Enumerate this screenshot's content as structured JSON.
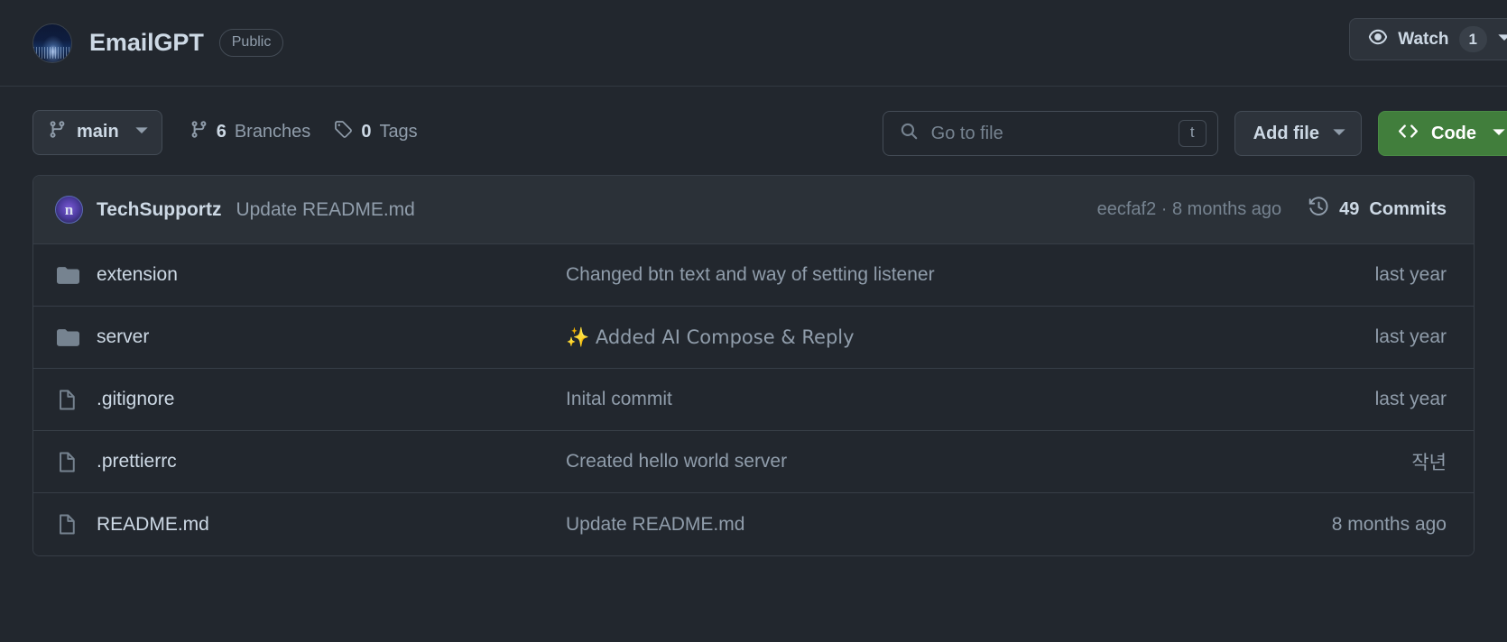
{
  "header": {
    "avatar_icon": "repo-avatar-night-city",
    "repo_name": "EmailGPT",
    "visibility": "Public",
    "watch": {
      "icon": "eye-icon",
      "label": "Watch",
      "count": "1",
      "caret_icon": "chevron-down-icon"
    }
  },
  "toolbar": {
    "branch": {
      "icon": "git-branch-icon",
      "name": "main",
      "caret_icon": "chevron-down-icon"
    },
    "branches": {
      "icon": "git-branch-icon",
      "count": "6",
      "label": "Branches"
    },
    "tags": {
      "icon": "tag-icon",
      "count": "0",
      "label": "Tags"
    },
    "search": {
      "icon": "search-icon",
      "placeholder": "Go to file",
      "value": "",
      "shortcut": "t"
    },
    "add_file": {
      "label": "Add file",
      "caret_icon": "chevron-down-icon"
    },
    "code": {
      "icon": "code-angle-brackets-icon",
      "label": "Code",
      "caret_icon": "chevron-down-icon"
    }
  },
  "commit_bar": {
    "avatar_letter": "n",
    "author": "TechSupportz",
    "message": "Update README.md",
    "hash_and_time": "eecfaf2 · 8 months ago",
    "history_icon": "clock-history-icon",
    "commits_count": "49",
    "commits_label": "Commits"
  },
  "files": [
    {
      "icon": "folder-icon",
      "type": "folder",
      "name": "extension",
      "message": "Changed btn text and way of setting listener",
      "time": "last year"
    },
    {
      "icon": "folder-icon",
      "type": "folder",
      "name": "server",
      "message": "✨ Added AI Compose & Reply",
      "time": "last year"
    },
    {
      "icon": "file-icon",
      "type": "file",
      "name": ".gitignore",
      "message": "Inital commit",
      "time": "last year"
    },
    {
      "icon": "file-icon",
      "type": "file",
      "name": ".prettierrc",
      "message": "Created hello world server",
      "time": "작년"
    },
    {
      "icon": "file-icon",
      "type": "file",
      "name": "README.md",
      "message": "Update README.md",
      "time": "8 months ago"
    }
  ],
  "colors": {
    "background": "#22272e",
    "surface": "#2d333b",
    "border": "#373e47",
    "text_primary": "#cdd9e5",
    "text_muted": "#909dab",
    "accent_green": "#417e3c"
  }
}
